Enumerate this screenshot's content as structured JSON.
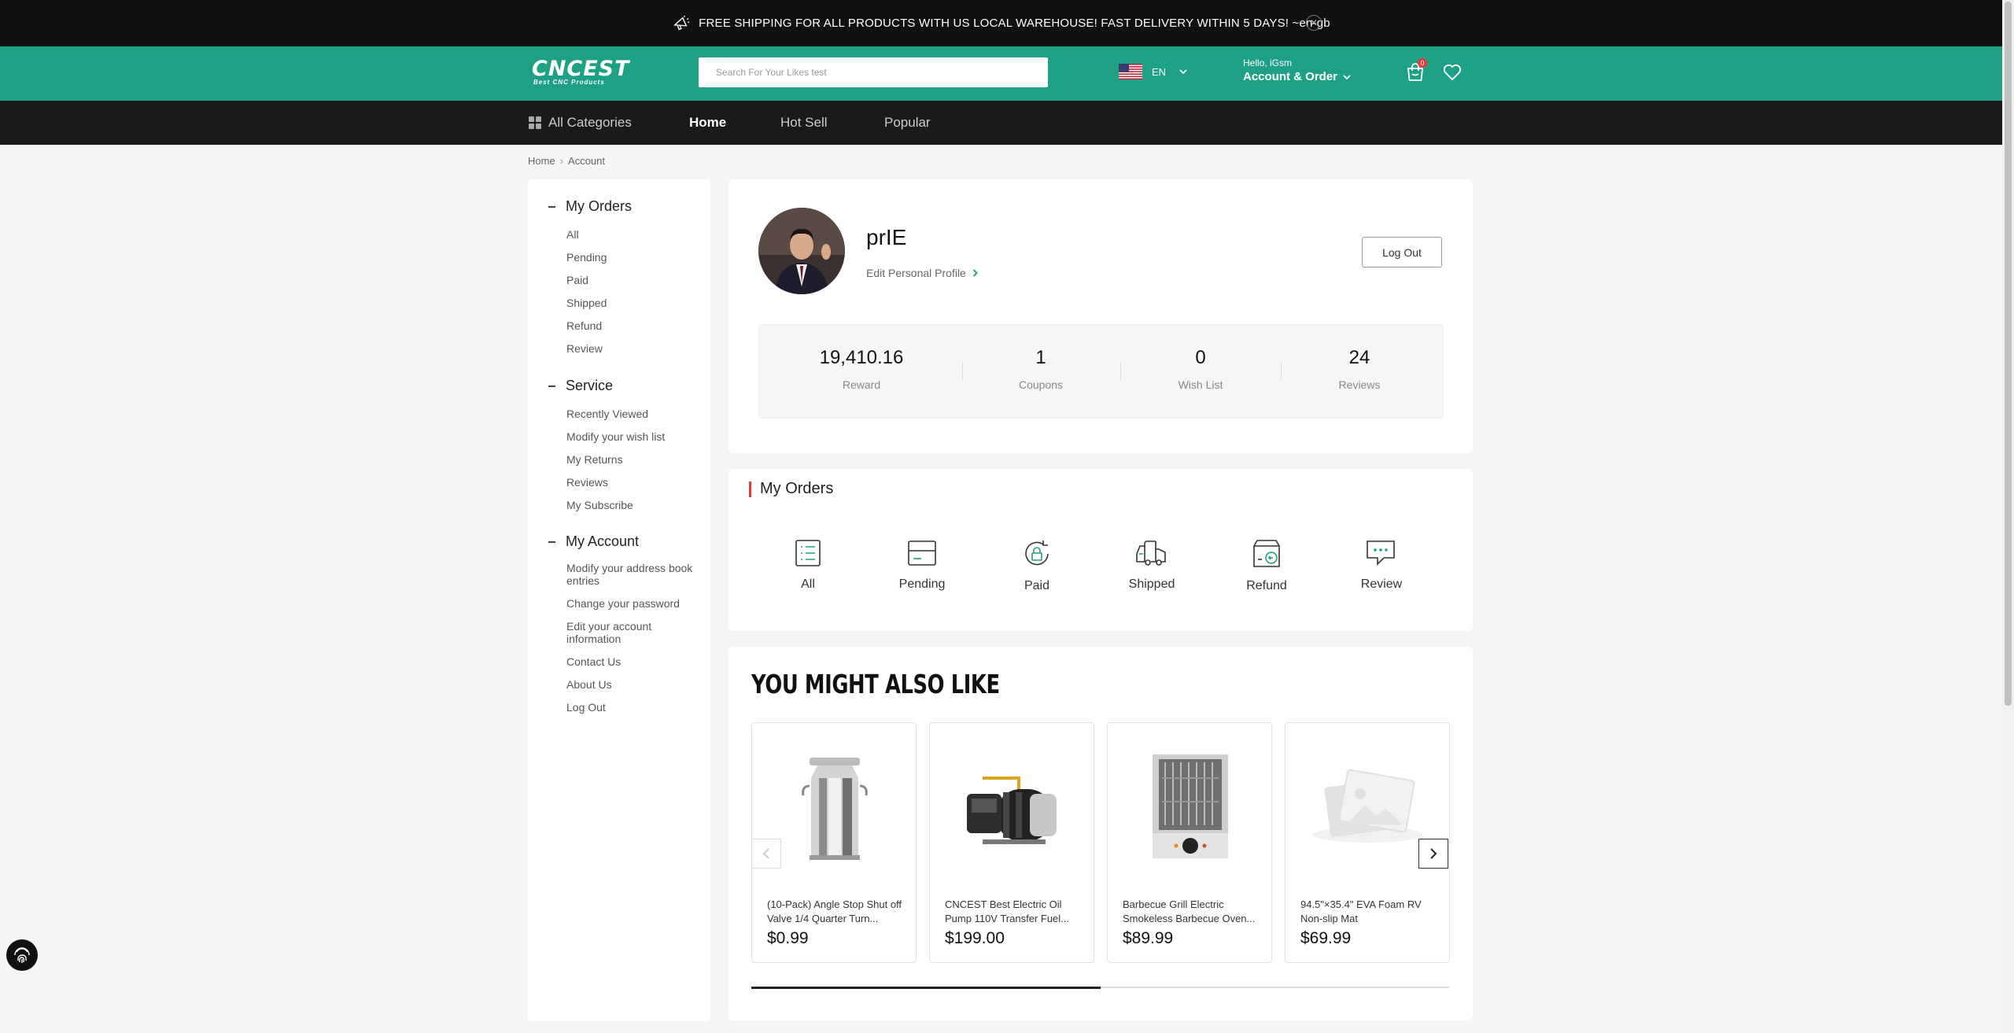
{
  "announcement": {
    "text": "FREE SHIPPING FOR ALL PRODUCTS WITH US LOCAL WAREHOUSE! FAST DELIVERY WITHIN 5 DAYS! ~en-gb"
  },
  "header": {
    "logo_main": "CNCEST",
    "logo_sub": "Best CNC Products",
    "search_placeholder": "Search For Your Likes test",
    "language": "EN",
    "hello": "Hello, iGsm",
    "account_order": "Account & Order",
    "cart_count": "0"
  },
  "nav": {
    "all_categories": "All Categories",
    "items": [
      "Home",
      "Hot Sell",
      "Popular"
    ],
    "active": "Home"
  },
  "breadcrumb": [
    "Home",
    "Account"
  ],
  "sidebar": {
    "groups": [
      {
        "title": "My Orders",
        "links": [
          "All",
          "Pending",
          "Paid",
          "Shipped",
          "Refund",
          "Review"
        ]
      },
      {
        "title": "Service",
        "links": [
          "Recently Viewed",
          "Modify your wish list",
          "My Returns",
          "Reviews",
          "My Subscribe"
        ]
      },
      {
        "title": "My Account",
        "links": [
          "Modify your address book entries",
          "Change your password",
          "Edit your account information",
          "Contact Us",
          "About Us",
          "Log Out"
        ]
      }
    ]
  },
  "profile": {
    "username": "prIE",
    "edit_label": "Edit Personal Profile",
    "logout_label": "Log Out",
    "stats": [
      {
        "value": "19,410.16",
        "label": "Reward"
      },
      {
        "value": "1",
        "label": "Coupons"
      },
      {
        "value": "0",
        "label": "Wish List"
      },
      {
        "value": "24",
        "label": "Reviews"
      }
    ]
  },
  "my_orders": {
    "title": "My Orders",
    "items": [
      "All",
      "Pending",
      "Paid",
      "Shipped",
      "Refund",
      "Review"
    ]
  },
  "recommendations": {
    "title": "YOU MIGHT ALSO LIKE",
    "products": [
      {
        "name": "(10-Pack) Angle Stop Shut off Valve 1/4 Quarter Turn...",
        "price": "$0.99"
      },
      {
        "name": "CNCEST Best Electric Oil Pump 110V Transfer Fuel...",
        "price": "$199.00"
      },
      {
        "name": "Barbecue Grill Electric Smokeless Barbecue Oven...",
        "price": "$89.99"
      },
      {
        "name": "94.5\"×35.4\" EVA Foam RV Non-slip Mat",
        "price": "$69.99"
      }
    ],
    "carousel_progress": 0.5
  },
  "colors": {
    "brand": "#1ea084",
    "nav_bg": "#1a1a1a",
    "accent_red": "#e53935"
  }
}
